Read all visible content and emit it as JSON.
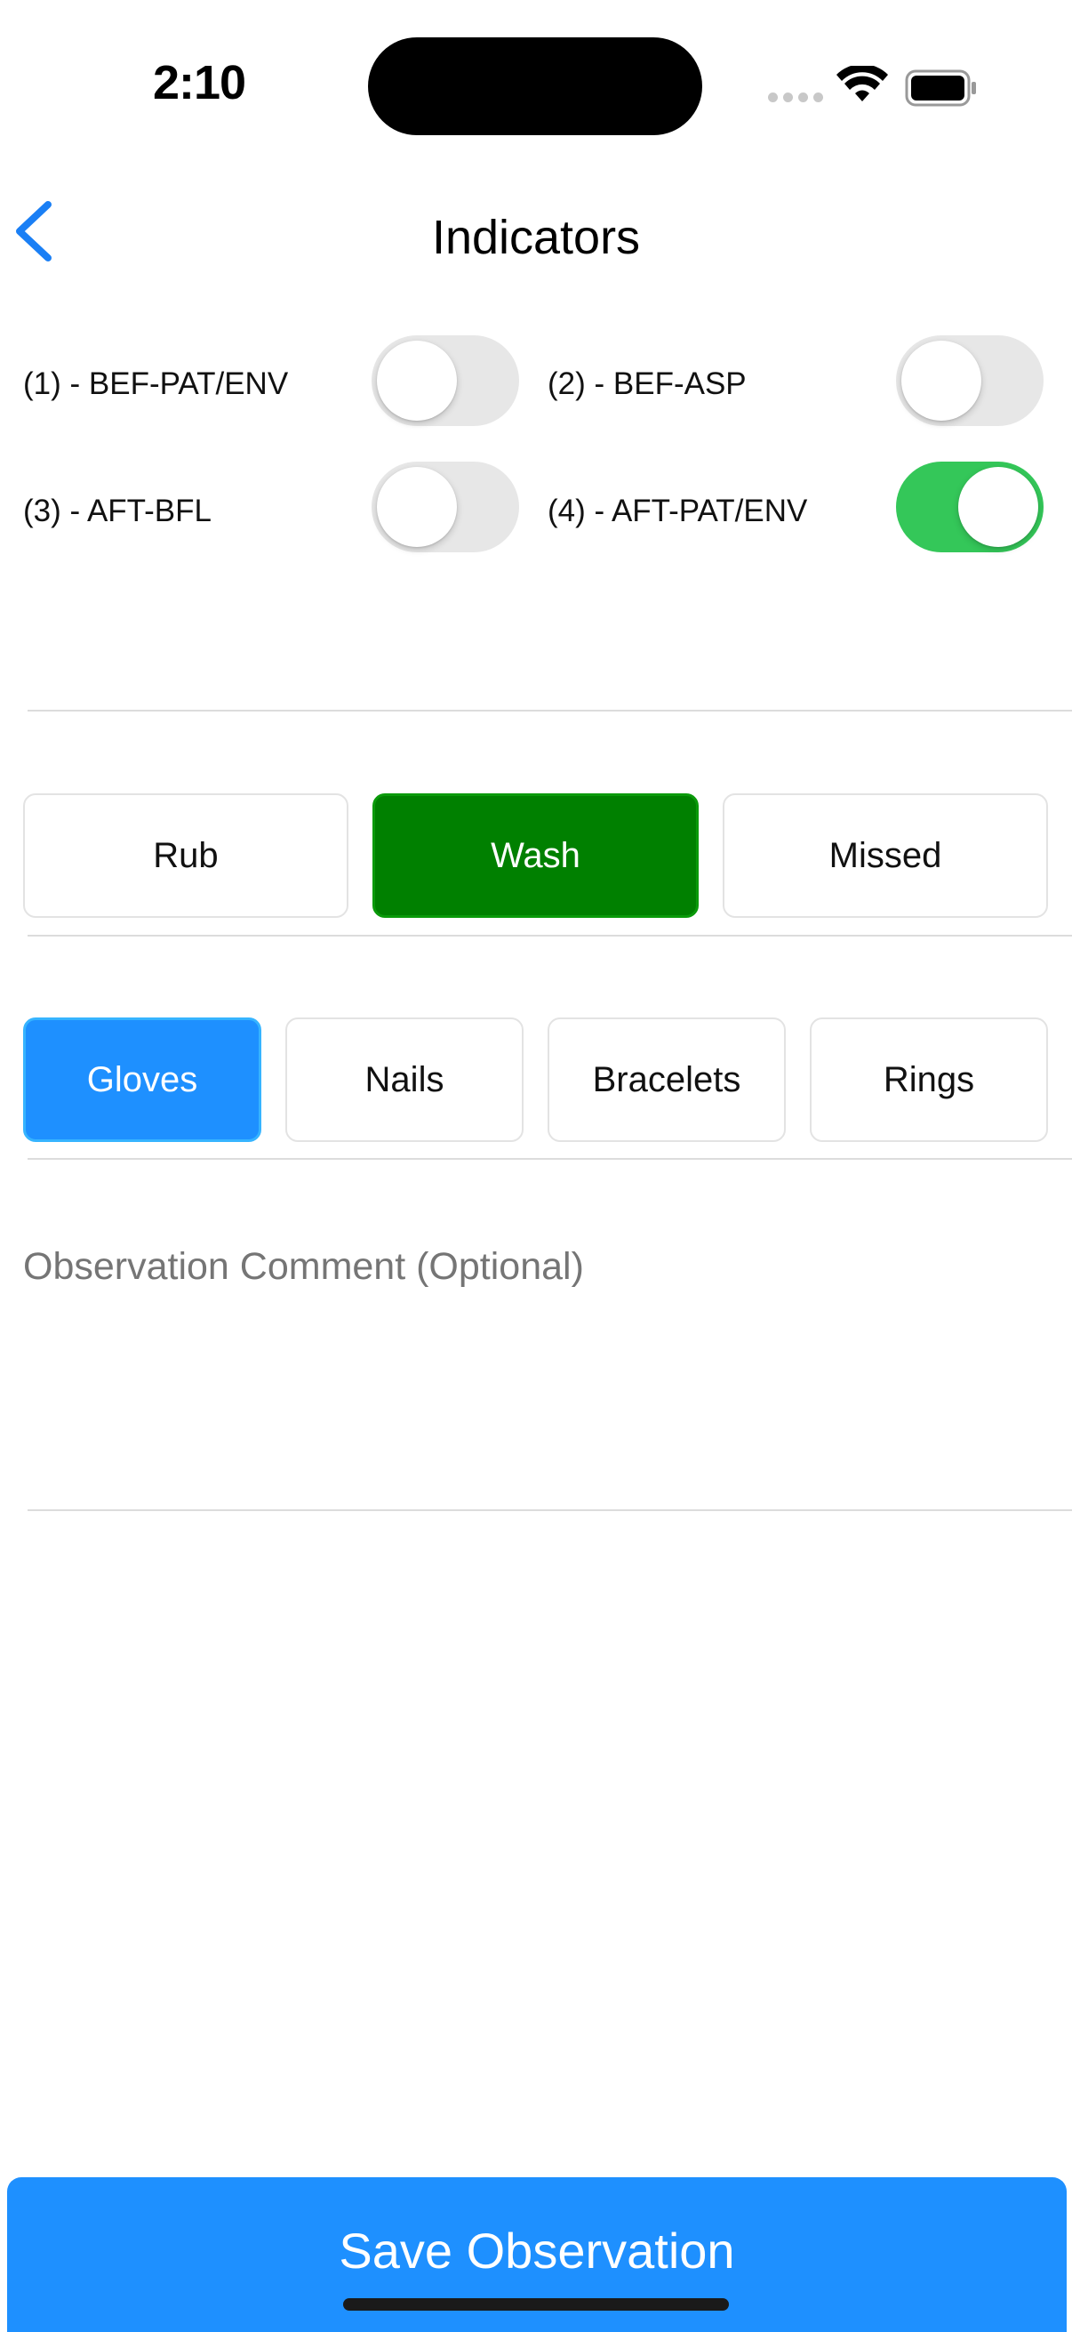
{
  "status_bar": {
    "time": "2:10"
  },
  "nav": {
    "title": "Indicators",
    "back_icon": "chevron-left-icon"
  },
  "indicators": [
    {
      "label": "(1) - BEF-PAT/ENV",
      "on": false
    },
    {
      "label": "(2) - BEF-ASP",
      "on": false
    },
    {
      "label": "(3) - AFT-BFL",
      "on": false
    },
    {
      "label": "(4) - AFT-PAT/ENV",
      "on": true
    }
  ],
  "action": {
    "options": [
      "Rub",
      "Wash",
      "Missed"
    ],
    "selected": "Wash"
  },
  "items": {
    "options": [
      "Gloves",
      "Nails",
      "Bracelets",
      "Rings"
    ],
    "selected": "Gloves"
  },
  "comment": {
    "placeholder": "Observation Comment (Optional)",
    "value": ""
  },
  "save": {
    "label": "Save Observation"
  },
  "colors": {
    "accent_blue": "#1e90ff",
    "wash_green": "#008000",
    "switch_on": "#34c759",
    "back_chevron": "#1a7ff5"
  }
}
